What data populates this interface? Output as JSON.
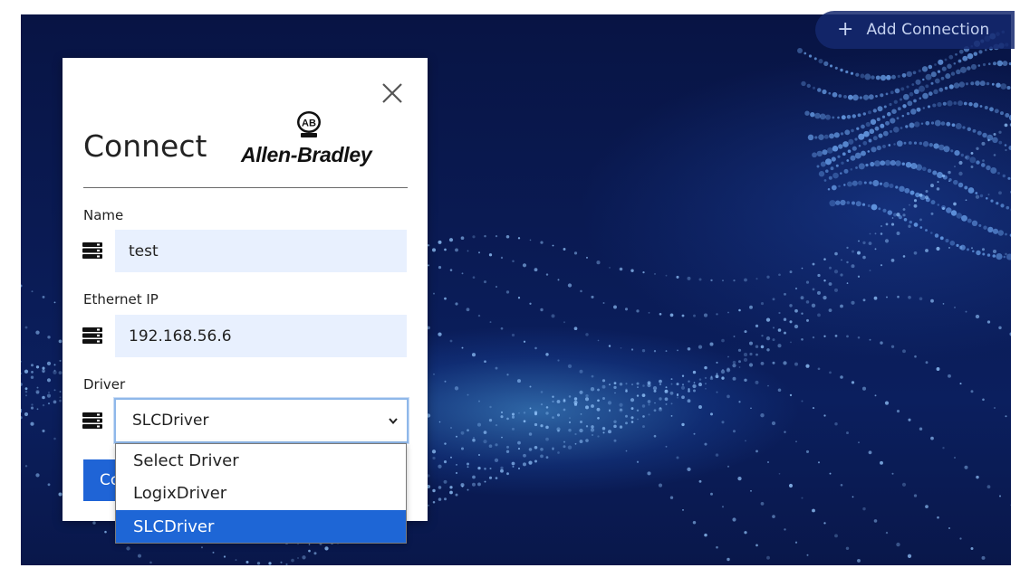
{
  "header": {
    "add_connection_icon": "plus-icon",
    "add_connection_label": "Add Connection"
  },
  "modal": {
    "title": "Connect",
    "brand": {
      "logo_text": "AB",
      "name": "Allen-Bradley"
    },
    "close_icon": "close-icon",
    "fields": {
      "name": {
        "label": "Name",
        "value": "test",
        "icon": "server-icon"
      },
      "ethernet_ip": {
        "label": "Ethernet IP",
        "value": "192.168.56.6",
        "icon": "server-icon"
      },
      "driver": {
        "label": "Driver",
        "value": "SLCDriver",
        "icon": "server-icon"
      }
    },
    "driver_options": [
      "Select Driver",
      "LogixDriver",
      "SLCDriver"
    ],
    "selected_driver": "SLCDriver",
    "connect_button_label": "Connect"
  },
  "colors": {
    "accent": "#1f64d6",
    "field_bg": "#e8f0fe",
    "background": "#0a1b55"
  }
}
